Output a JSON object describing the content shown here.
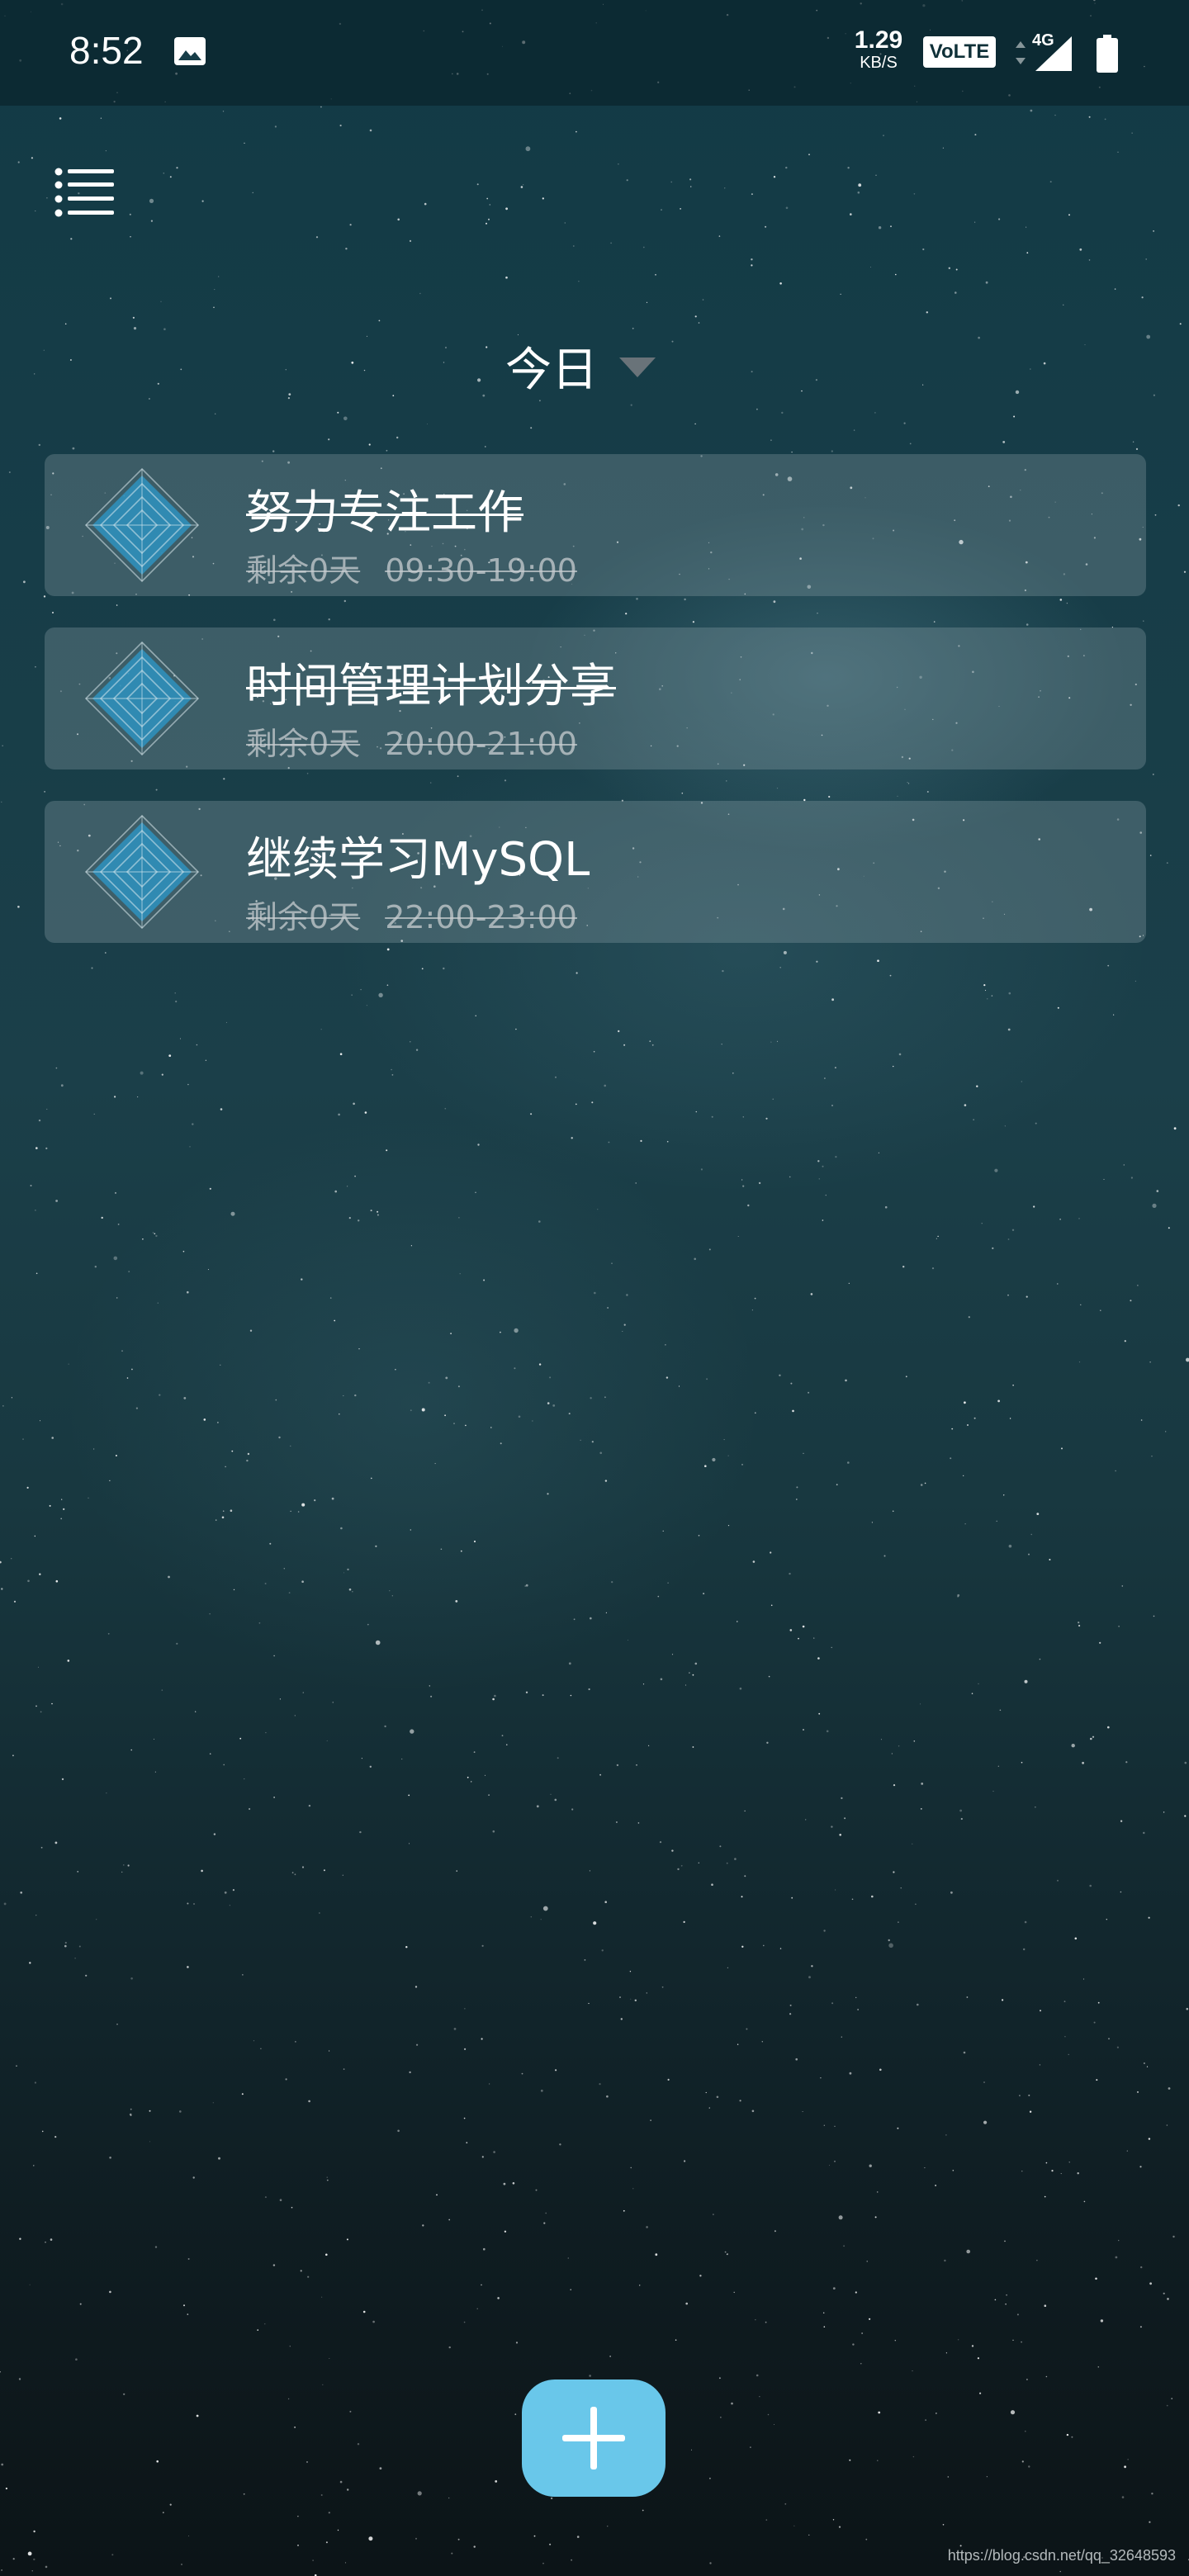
{
  "status_bar": {
    "time": "8:52",
    "net_speed_value": "1.29",
    "net_speed_unit": "KB/S",
    "volte_label": "VoLTE",
    "network_type": "4G",
    "icons": [
      "gallery-icon",
      "signal-icon",
      "battery-icon"
    ]
  },
  "toolbar": {
    "menu_icon": "list-menu-icon"
  },
  "header": {
    "title": "今日",
    "dropdown_icon": "triangle-down-icon"
  },
  "tasks": [
    {
      "title": "努力专注工作",
      "title_done": true,
      "remaining": "剩余0天",
      "time": "09:30-19:00",
      "icon": "radar-diamond-icon"
    },
    {
      "title": "时间管理计划分享",
      "title_done": true,
      "remaining": "剩余0天",
      "time": "20:00-21:00",
      "icon": "radar-diamond-icon"
    },
    {
      "title": "继续学习MySQL",
      "title_done": false,
      "remaining": "剩余0天",
      "time": "22:00-23:00",
      "icon": "radar-diamond-icon"
    }
  ],
  "fab": {
    "icon": "plus-icon"
  },
  "watermark": "https://blog.csdn.net/qq_32648593",
  "colors": {
    "accent": "#69c7ea",
    "icon_fill": "#2f8fba",
    "card_bg": "rgba(150,170,175,0.30)"
  }
}
